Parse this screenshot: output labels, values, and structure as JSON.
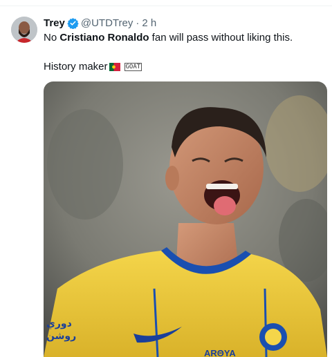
{
  "tweet": {
    "author_name": "Trey",
    "handle": "@UTDTrey",
    "separator": "·",
    "time": "2 h",
    "text_prefix": "No ",
    "text_bold": "Cristiano Ronaldo",
    "text_suffix": " fan will pass without liking this.",
    "line2": "History maker",
    "goat_label": "GOAT"
  },
  "media": {
    "jersey_sponsor": "ARΘYA",
    "jersey_sleeve_text": "دوري\nروشن",
    "colors": {
      "jersey": "#f0cf3a",
      "background": "#8a8a82",
      "verified": "#1d9bf0"
    }
  }
}
